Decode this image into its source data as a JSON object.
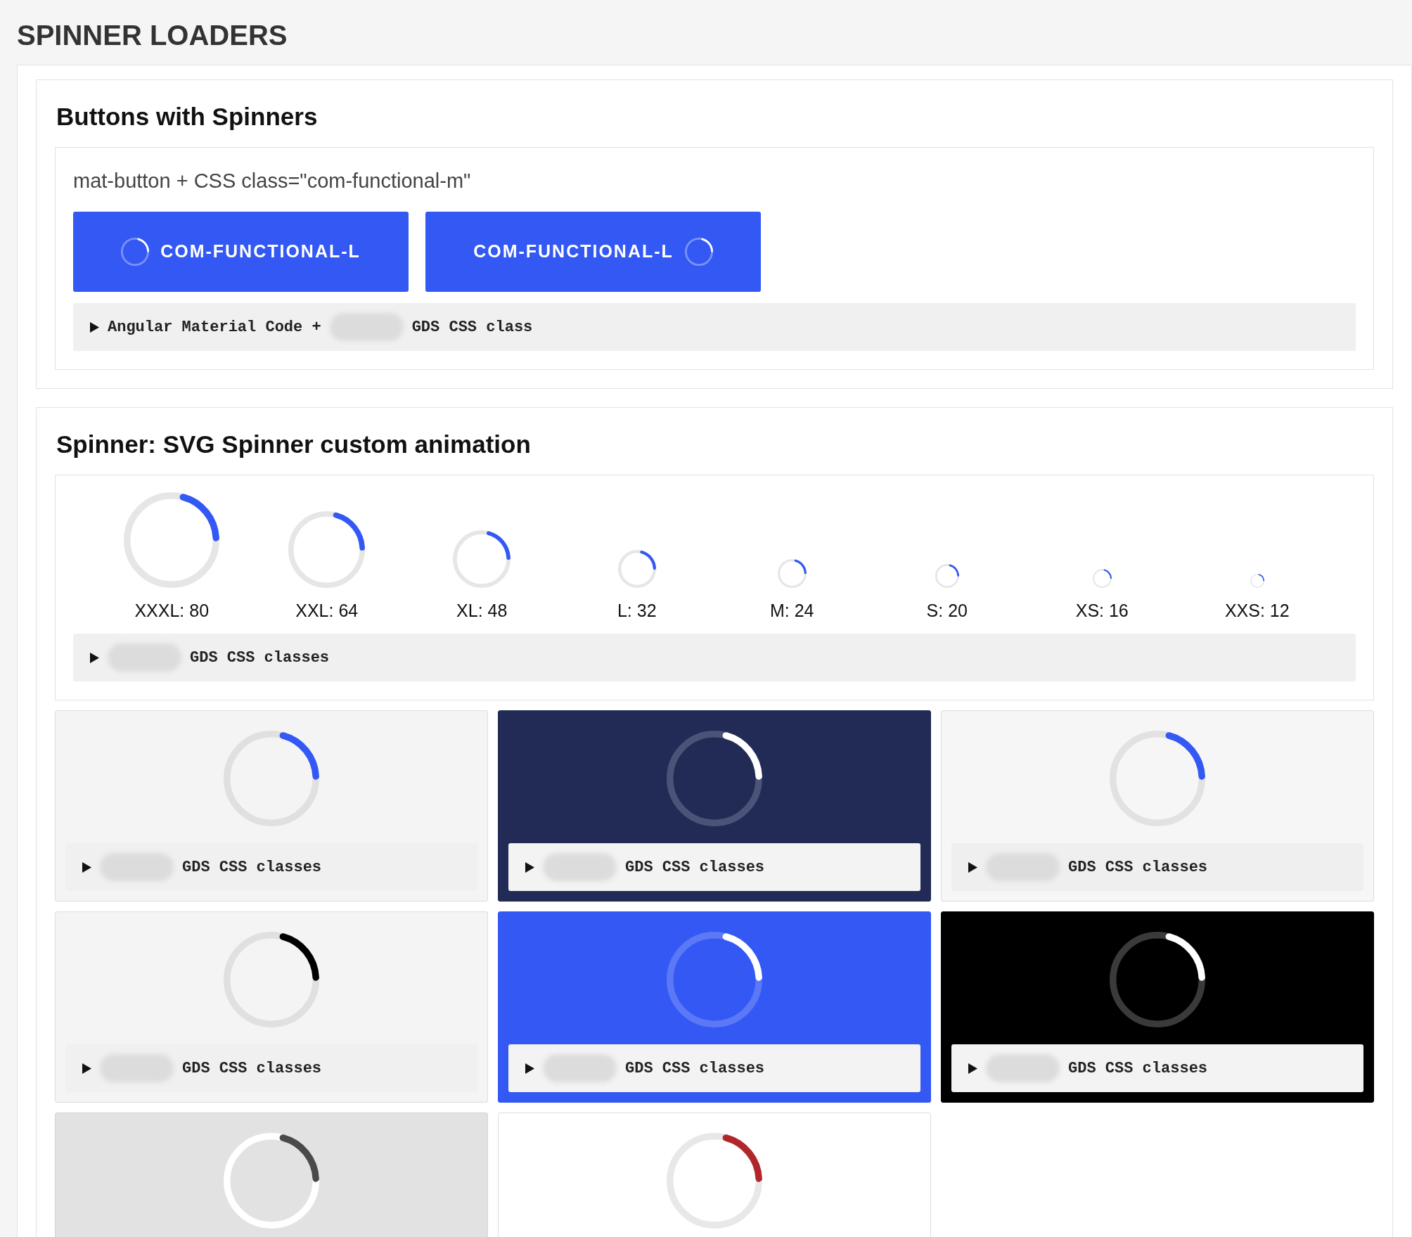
{
  "page_title": "SPINNER LOADERS",
  "button_section": {
    "title": "Buttons with Spinners",
    "caption": "mat-button + CSS class=\"com-functional-m\"",
    "buttons": [
      {
        "label": "COM-FUNCTIONAL-L",
        "kind": "leading"
      },
      {
        "label": "COM-FUNCTIONAL-L",
        "kind": "trailing"
      }
    ],
    "code_toggle": {
      "before": "Angular Material Code +",
      "after": "GDS CSS class"
    }
  },
  "spinner_section": {
    "title": "Spinner: SVG Spinner custom animation",
    "sizes": [
      {
        "label": "XXXL: 80"
      },
      {
        "label": "XXL: 64"
      },
      {
        "label": "XL: 48"
      },
      {
        "label": "L: 32"
      },
      {
        "label": "M: 24"
      },
      {
        "label": "S: 20"
      },
      {
        "label": "XS: 16"
      },
      {
        "label": "XXS: 12"
      }
    ],
    "code_toggle": {
      "label": "GDS CSS classes"
    },
    "tiles": [
      {
        "kind": "default",
        "code_label": "GDS CSS classes"
      },
      {
        "kind": "navy",
        "code_label": "GDS CSS classes"
      },
      {
        "kind": "muted",
        "code_label": "GDS CSS classes"
      },
      {
        "kind": "mono",
        "code_label": "GDS CSS classes"
      },
      {
        "kind": "brand",
        "code_label": "GDS CSS classes"
      },
      {
        "kind": "dark",
        "code_label": "GDS CSS classes"
      },
      {
        "kind": "grey"
      },
      {
        "kind": "danger"
      }
    ]
  }
}
